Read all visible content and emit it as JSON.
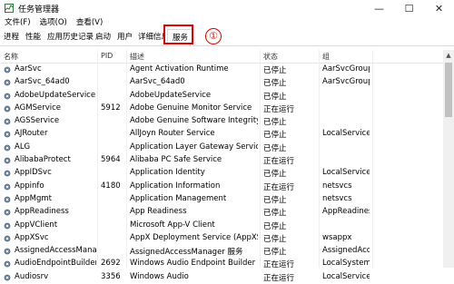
{
  "window": {
    "title": "任务管理器",
    "min": "—",
    "max": "☐",
    "close": "✕"
  },
  "menu": [
    "文件(F)",
    "选项(O)",
    "查看(V)"
  ],
  "tabs": [
    "进程",
    "性能",
    "应用历史记录",
    "启动",
    "用户",
    "详细信息",
    "服务"
  ],
  "annotation": {
    "number": "①"
  },
  "columns": {
    "name": "名称",
    "pid": "PID",
    "desc": "描述",
    "status": "状态",
    "group": "组"
  },
  "rows": [
    {
      "name": "AarSvc",
      "pid": "",
      "desc": "Agent Activation Runtime",
      "status": "已停止",
      "group": "AarSvcGroup"
    },
    {
      "name": "AarSvc_64ad0",
      "pid": "",
      "desc": "AarSvc_64ad0",
      "status": "已停止",
      "group": "AarSvcGroup"
    },
    {
      "name": "AdobeUpdateService",
      "pid": "",
      "desc": "AdobeUpdateService",
      "status": "已停止",
      "group": ""
    },
    {
      "name": "AGMService",
      "pid": "5912",
      "desc": "Adobe Genuine Monitor Service",
      "status": "正在运行",
      "group": ""
    },
    {
      "name": "AGSService",
      "pid": "",
      "desc": "Adobe Genuine Software Integrity ...",
      "status": "已停止",
      "group": ""
    },
    {
      "name": "AJRouter",
      "pid": "",
      "desc": "AllJoyn Router Service",
      "status": "已停止",
      "group": "LocalService..."
    },
    {
      "name": "ALG",
      "pid": "",
      "desc": "Application Layer Gateway Service",
      "status": "已停止",
      "group": ""
    },
    {
      "name": "AlibabaProtect",
      "pid": "5964",
      "desc": "Alibaba PC Safe Service",
      "status": "正在运行",
      "group": ""
    },
    {
      "name": "AppIDSvc",
      "pid": "",
      "desc": "Application Identity",
      "status": "已停止",
      "group": "LocalService..."
    },
    {
      "name": "Appinfo",
      "pid": "4180",
      "desc": "Application Information",
      "status": "正在运行",
      "group": "netsvcs"
    },
    {
      "name": "AppMgmt",
      "pid": "",
      "desc": "Application Management",
      "status": "已停止",
      "group": "netsvcs"
    },
    {
      "name": "AppReadiness",
      "pid": "",
      "desc": "App Readiness",
      "status": "已停止",
      "group": "AppReadiness"
    },
    {
      "name": "AppVClient",
      "pid": "",
      "desc": "Microsoft App-V Client",
      "status": "已停止",
      "group": ""
    },
    {
      "name": "AppXSvc",
      "pid": "",
      "desc": "AppX Deployment Service (AppXSV...",
      "status": "已停止",
      "group": "wsappx"
    },
    {
      "name": "AssignedAccessMana...",
      "pid": "",
      "desc": "AssignedAccessManager 服务",
      "status": "已停止",
      "group": "AssignedAcc..."
    },
    {
      "name": "AudioEndpointBuilder",
      "pid": "2692",
      "desc": "Windows Audio Endpoint Builder",
      "status": "正在运行",
      "group": "LocalSystem..."
    },
    {
      "name": "Audiosrv",
      "pid": "3356",
      "desc": "Windows Audio",
      "status": "正在运行",
      "group": "LocalService..."
    }
  ]
}
